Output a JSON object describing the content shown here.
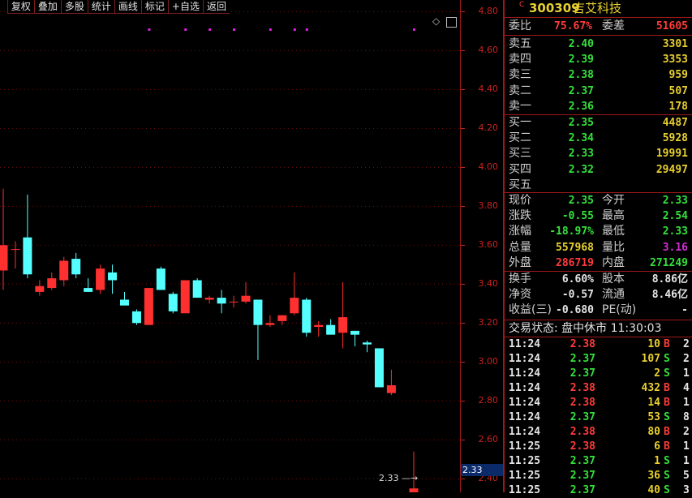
{
  "toolbar": {
    "items": [
      "复权",
      "叠加",
      "多股",
      "统计",
      "画线",
      "标记",
      "+自选",
      "返回"
    ],
    "diamond": "◇"
  },
  "axis": {
    "ticks": [
      "4.80",
      "4.60",
      "4.40",
      "4.20",
      "4.00",
      "3.80",
      "3.60",
      "3.40",
      "3.20",
      "3.00",
      "2.80",
      "2.60",
      "2.40"
    ],
    "current_price_tag": "2.33",
    "last_price_label": "2.33"
  },
  "colors": {
    "up": "#ff3030",
    "down": "#54ffff",
    "grid": "#6b1010",
    "marker": "#e020e0",
    "panel_border": "#a01818"
  },
  "chart_data": {
    "type": "candlestick",
    "ylim": [
      2.33,
      4.86
    ],
    "candles": [
      {
        "o": 3.47,
        "h": 3.89,
        "l": 3.37,
        "c": 3.6
      },
      {
        "o": 3.58,
        "h": 3.62,
        "l": 3.48,
        "c": 3.58
      },
      {
        "o": 3.64,
        "h": 3.86,
        "l": 3.43,
        "c": 3.45
      },
      {
        "o": 3.36,
        "h": 3.42,
        "l": 3.34,
        "c": 3.39
      },
      {
        "o": 3.38,
        "h": 3.46,
        "l": 3.37,
        "c": 3.43
      },
      {
        "o": 3.42,
        "h": 3.54,
        "l": 3.39,
        "c": 3.52
      },
      {
        "o": 3.53,
        "h": 3.56,
        "l": 3.43,
        "c": 3.45
      },
      {
        "o": 3.38,
        "h": 3.43,
        "l": 3.37,
        "c": 3.36
      },
      {
        "o": 3.37,
        "h": 3.5,
        "l": 3.35,
        "c": 3.48
      },
      {
        "o": 3.46,
        "h": 3.5,
        "l": 3.35,
        "c": 3.42
      },
      {
        "o": 3.32,
        "h": 3.36,
        "l": 3.29,
        "c": 3.29
      },
      {
        "o": 3.26,
        "h": 3.27,
        "l": 3.19,
        "c": 3.2
      },
      {
        "o": 3.19,
        "h": 3.38,
        "l": 3.19,
        "c": 3.38
      },
      {
        "o": 3.48,
        "h": 3.49,
        "l": 3.37,
        "c": 3.37
      },
      {
        "o": 3.35,
        "h": 3.36,
        "l": 3.25,
        "c": 3.26
      },
      {
        "o": 3.25,
        "h": 3.42,
        "l": 3.26,
        "c": 3.42
      },
      {
        "o": 3.42,
        "h": 3.43,
        "l": 3.33,
        "c": 3.33
      },
      {
        "o": 3.32,
        "h": 3.34,
        "l": 3.3,
        "c": 3.33
      },
      {
        "o": 3.33,
        "h": 3.37,
        "l": 3.25,
        "c": 3.3
      },
      {
        "o": 3.31,
        "h": 3.34,
        "l": 3.28,
        "c": 3.31
      },
      {
        "o": 3.31,
        "h": 3.41,
        "l": 3.3,
        "c": 3.34
      },
      {
        "o": 3.32,
        "h": 3.32,
        "l": 3.01,
        "c": 3.19
      },
      {
        "o": 3.19,
        "h": 3.24,
        "l": 3.18,
        "c": 3.2
      },
      {
        "o": 3.21,
        "h": 3.24,
        "l": 3.19,
        "c": 3.24
      },
      {
        "o": 3.25,
        "h": 3.46,
        "l": 3.24,
        "c": 3.33
      },
      {
        "o": 3.32,
        "h": 3.33,
        "l": 3.13,
        "c": 3.15
      },
      {
        "o": 3.18,
        "h": 3.21,
        "l": 3.13,
        "c": 3.19
      },
      {
        "o": 3.19,
        "h": 3.22,
        "l": 3.15,
        "c": 3.14
      },
      {
        "o": 3.15,
        "h": 3.41,
        "l": 3.07,
        "c": 3.23
      },
      {
        "o": 3.16,
        "h": 3.16,
        "l": 3.08,
        "c": 3.14
      },
      {
        "o": 3.1,
        "h": 3.11,
        "l": 3.05,
        "c": 3.09
      },
      {
        "o": 3.07,
        "h": 3.07,
        "l": 2.87,
        "c": 2.87
      },
      {
        "o": 2.84,
        "h": 2.96,
        "l": 2.83,
        "c": 2.88
      },
      {
        "o": 2.33,
        "h": 2.54,
        "l": 2.33,
        "c": 2.35
      }
    ],
    "markers_after_index": [
      12,
      15,
      17,
      19,
      22,
      24,
      25,
      33
    ]
  },
  "quote": {
    "code": "300309",
    "name": "吉艾科技",
    "weibi_label": "委比",
    "weibi": "75.67%",
    "weicha_label": "委差",
    "weicha": "51605",
    "asks": [
      {
        "label": "卖五",
        "price": "2.40",
        "vol": "3301"
      },
      {
        "label": "卖四",
        "price": "2.39",
        "vol": "3353"
      },
      {
        "label": "卖三",
        "price": "2.38",
        "vol": "959"
      },
      {
        "label": "卖二",
        "price": "2.37",
        "vol": "507"
      },
      {
        "label": "卖一",
        "price": "2.36",
        "vol": "178"
      }
    ],
    "bids": [
      {
        "label": "买一",
        "price": "2.35",
        "vol": "4487"
      },
      {
        "label": "买二",
        "price": "2.34",
        "vol": "5928"
      },
      {
        "label": "买三",
        "price": "2.33",
        "vol": "19991"
      },
      {
        "label": "买四",
        "price": "2.32",
        "vol": "29497"
      },
      {
        "label": "买五",
        "price": "",
        "vol": ""
      }
    ],
    "stats": [
      {
        "l1": "现价",
        "v1": "2.35",
        "c1": "g",
        "l2": "今开",
        "v2": "2.33",
        "c2": "g"
      },
      {
        "l1": "涨跌",
        "v1": "-0.55",
        "c1": "g",
        "l2": "最高",
        "v2": "2.54",
        "c2": "g"
      },
      {
        "l1": "涨幅",
        "v1": "-18.97%",
        "c1": "g",
        "l2": "最低",
        "v2": "2.33",
        "c2": "g"
      },
      {
        "l1": "总量",
        "v1": "557968",
        "c1": "y",
        "l2": "量比",
        "v2": "3.16",
        "c2": "m"
      },
      {
        "l1": "外盘",
        "v1": "286719",
        "c1": "r",
        "l2": "内盘",
        "v2": "271249",
        "c2": "g"
      }
    ],
    "fund": [
      {
        "l1": "换手",
        "v1": "6.60%",
        "l2": "股本",
        "v2": "8.86亿"
      },
      {
        "l1": "净资",
        "v1": "-0.57",
        "l2": "流通",
        "v2": "8.46亿"
      },
      {
        "l1": "收益(三)",
        "v1": "-0.680",
        "l2": "PE(动)",
        "v2": "-"
      }
    ],
    "trade_status": "交易状态: 盘中休市 11:30:03",
    "trades": [
      {
        "t": "11:24",
        "p": "2.38",
        "v": "10",
        "s": "B",
        "n": "2"
      },
      {
        "t": "11:24",
        "p": "2.37",
        "v": "107",
        "s": "S",
        "n": "2"
      },
      {
        "t": "11:24",
        "p": "2.37",
        "v": "2",
        "s": "S",
        "n": "1"
      },
      {
        "t": "11:24",
        "p": "2.38",
        "v": "432",
        "s": "B",
        "n": "4"
      },
      {
        "t": "11:24",
        "p": "2.38",
        "v": "14",
        "s": "B",
        "n": "1"
      },
      {
        "t": "11:24",
        "p": "2.37",
        "v": "53",
        "s": "S",
        "n": "8"
      },
      {
        "t": "11:24",
        "p": "2.38",
        "v": "80",
        "s": "B",
        "n": "2"
      },
      {
        "t": "11:25",
        "p": "2.38",
        "v": "6",
        "s": "B",
        "n": "1"
      },
      {
        "t": "11:25",
        "p": "2.37",
        "v": "1",
        "s": "S",
        "n": "1"
      },
      {
        "t": "11:25",
        "p": "2.37",
        "v": "36",
        "s": "S",
        "n": "5"
      },
      {
        "t": "11:25",
        "p": "2.37",
        "v": "40",
        "s": "S",
        "n": "3"
      }
    ]
  }
}
